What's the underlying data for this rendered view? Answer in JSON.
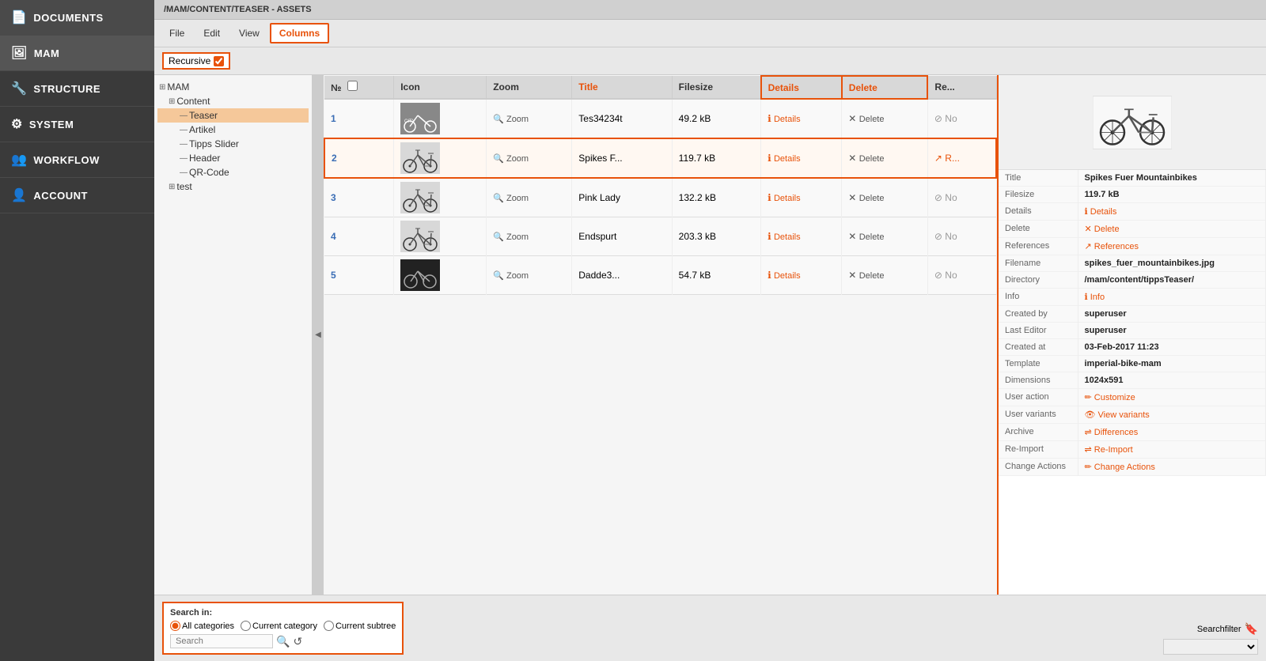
{
  "sidebar": {
    "items": [
      {
        "id": "documents",
        "label": "DOCUMENTS",
        "icon": "📄"
      },
      {
        "id": "mam",
        "label": "MAM",
        "icon": "🖼",
        "active": true
      },
      {
        "id": "structure",
        "label": "STRUCTURE",
        "icon": "🔧"
      },
      {
        "id": "system",
        "label": "SYSTEM",
        "icon": "⚙"
      },
      {
        "id": "workflow",
        "label": "WORKFLOW",
        "icon": "👤"
      },
      {
        "id": "account",
        "label": "ACCOUNT",
        "icon": "👤"
      }
    ]
  },
  "breadcrumb": "/MAM/CONTENT/TEASER - ASSETS",
  "menubar": {
    "items": [
      {
        "label": "File",
        "active": false
      },
      {
        "label": "Edit",
        "active": false
      },
      {
        "label": "View",
        "active": false
      },
      {
        "label": "Columns",
        "active": true
      }
    ]
  },
  "toolbar": {
    "recursive_label": "Recursive",
    "recursive_checked": true
  },
  "tree": {
    "nodes": [
      {
        "label": "MAM",
        "indent": 0,
        "expandable": true
      },
      {
        "label": "Content",
        "indent": 1,
        "expandable": true
      },
      {
        "label": "Teaser",
        "indent": 2,
        "expandable": false,
        "selected": true
      },
      {
        "label": "Artikel",
        "indent": 2,
        "expandable": false
      },
      {
        "label": "Tipps Slider",
        "indent": 2,
        "expandable": false
      },
      {
        "label": "Header",
        "indent": 2,
        "expandable": false
      },
      {
        "label": "QR-Code",
        "indent": 2,
        "expandable": false
      },
      {
        "label": "test",
        "indent": 1,
        "expandable": true
      }
    ]
  },
  "table": {
    "columns": [
      {
        "label": "№",
        "style": "normal"
      },
      {
        "label": "Icon",
        "style": "normal"
      },
      {
        "label": "Zoom",
        "style": "normal"
      },
      {
        "label": "Title",
        "style": "orange"
      },
      {
        "label": "Filesize",
        "style": "normal"
      },
      {
        "label": "Details",
        "style": "highlighted"
      },
      {
        "label": "Delete",
        "style": "highlighted"
      },
      {
        "label": "Re...",
        "style": "normal"
      }
    ],
    "rows": [
      {
        "num": "1",
        "thumb_type": "city",
        "zoom": "Zoom",
        "title": "Tes34234t",
        "filesize": "49.2 kB",
        "details": "Details",
        "delete": "Delete",
        "extra": "No",
        "selected": false
      },
      {
        "num": "2",
        "thumb_type": "bike",
        "zoom": "Zoom",
        "title": "Spikes F...",
        "filesize": "119.7 kB",
        "details": "Details",
        "delete": "Delete",
        "extra": "R...",
        "selected": true
      },
      {
        "num": "3",
        "thumb_type": "bike2",
        "zoom": "Zoom",
        "title": "Pink Lady",
        "filesize": "132.2 kB",
        "details": "Details",
        "delete": "Delete",
        "extra": "No",
        "selected": false
      },
      {
        "num": "4",
        "thumb_type": "bike3",
        "zoom": "Zoom",
        "title": "Endspurt",
        "filesize": "203.3 kB",
        "details": "Details",
        "delete": "Delete",
        "extra": "No",
        "selected": false
      },
      {
        "num": "5",
        "thumb_type": "dark",
        "zoom": "Zoom",
        "title": "Dadde3...",
        "filesize": "54.7 kB",
        "details": "Details",
        "delete": "Delete",
        "extra": "No",
        "selected": false
      }
    ]
  },
  "detail_panel": {
    "title_label": "Title",
    "title_value": "Spikes Fuer Mountainbikes",
    "filesize_label": "Filesize",
    "filesize_value": "119.7 kB",
    "details_label": "Details",
    "details_link": "Details",
    "delete_label": "Delete",
    "delete_link": "Delete",
    "references_label": "References",
    "references_link": "References",
    "filename_label": "Filename",
    "filename_value": "spikes_fuer_mountainbikes.jpg",
    "directory_label": "Directory",
    "directory_value": "/mam/content/tippsTeaser/",
    "info_label": "Info",
    "info_link": "Info",
    "created_by_label": "Created by",
    "created_by_value": "superuser",
    "last_editor_label": "Last Editor",
    "last_editor_value": "superuser",
    "created_at_label": "Created at",
    "created_at_value": "03-Feb-2017 11:23",
    "template_label": "Template",
    "template_value": "imperial-bike-mam",
    "dimensions_label": "Dimensions",
    "dimensions_value": "1024x591",
    "user_action_label": "User action",
    "user_action_link": "Customize",
    "user_variants_label": "User variants",
    "user_variants_link": "View variants",
    "archive_label": "Archive",
    "archive_link": "Differences",
    "reimport_label": "Re-Import",
    "reimport_link": "Re-Import",
    "change_actions_label": "Change Actions",
    "change_actions_link": "Change Actions"
  },
  "bottom": {
    "search_in_label": "Search in:",
    "radio_all": "All categories",
    "radio_current": "Current category",
    "radio_subtree": "Current subtree",
    "search_placeholder": "Search",
    "searchfilter_label": "Searchfilter"
  }
}
